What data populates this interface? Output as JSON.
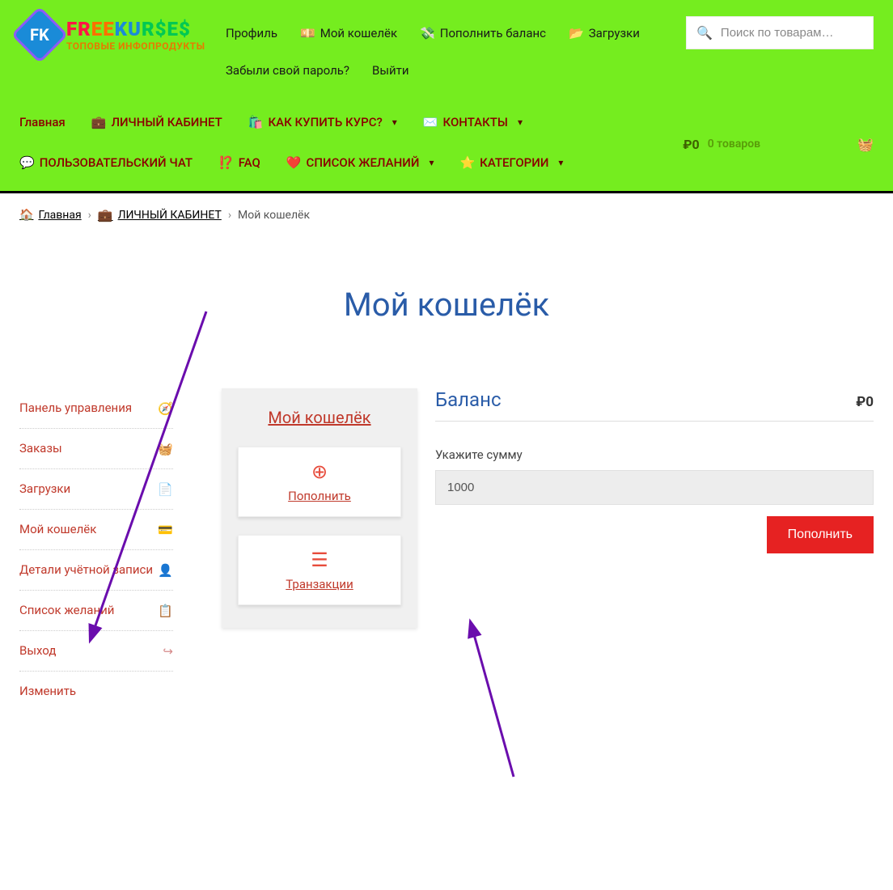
{
  "logo": {
    "badge": "FK",
    "title_parts": [
      "FR",
      "EE",
      "KU",
      "R$E$"
    ],
    "subtitle": "ТОПОВЫЕ ИНФОПРОДУКТЫ"
  },
  "top_menu": {
    "profile": "Профиль",
    "wallet": "Мой кошелёк",
    "topup": "Пополнить баланс",
    "downloads": "Загрузки",
    "forgot": "Забыли свой пароль?",
    "logout": "Выйти"
  },
  "search": {
    "placeholder": "Поиск по товарам…"
  },
  "nav": {
    "home": "Главная",
    "account": "ЛИЧНЫЙ КАБИНЕТ",
    "howbuy": "КАК КУПИТЬ КУРС?",
    "contacts": "КОНТАКТЫ",
    "chat": "ПОЛЬЗОВАТЕЛЬСКИЙ ЧАТ",
    "faq": "FAQ",
    "wishlist": "СПИСОК ЖЕЛАНИЙ",
    "categories": "КАТЕГОРИИ"
  },
  "cart": {
    "amount": "₽0",
    "items": "0 товаров"
  },
  "breadcrumb": {
    "home": "Главная",
    "account": "ЛИЧНЫЙ КАБИНЕТ",
    "current": "Мой кошелёк"
  },
  "page_title": "Мой кошелёк",
  "sidebar": {
    "dashboard": "Панель управления",
    "orders": "Заказы",
    "downloads": "Загрузки",
    "wallet": "Мой кошелёк",
    "account": "Детали учётной записи",
    "wishlist": "Список желаний",
    "logout": "Выход",
    "change": "Изменить"
  },
  "wallet_panel": {
    "title": "Мой кошелёк",
    "topup": "Пополнить",
    "transactions": "Транзакции"
  },
  "balance": {
    "label": "Баланс",
    "amount": "₽0",
    "input_label": "Укажите сумму",
    "input_value": "1000",
    "submit": "Пополнить"
  }
}
